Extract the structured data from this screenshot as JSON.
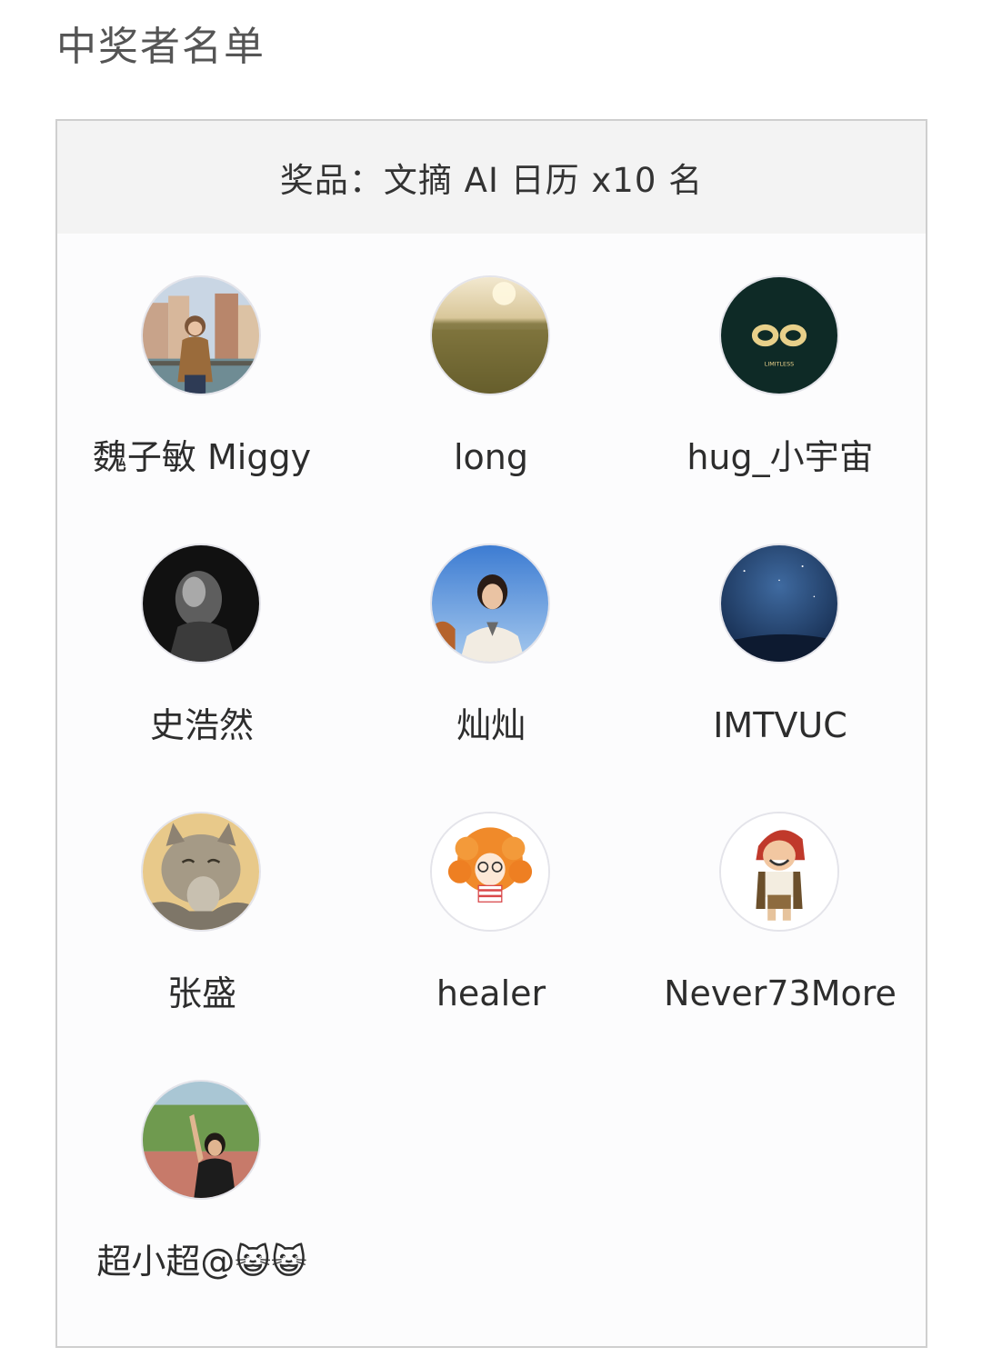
{
  "page": {
    "title": "中奖者名单"
  },
  "prize": {
    "label": "奖品：文摘 AI 日历 x10 名"
  },
  "winners": [
    {
      "name": "魏子敏 Miggy",
      "avatar": "photo-avatar-venice"
    },
    {
      "name": "long",
      "avatar": "photo-avatar-wheat-field"
    },
    {
      "name": "hug_小宇宙",
      "avatar": "logo-avatar-limitless"
    },
    {
      "name": "史浩然",
      "avatar": "photo-avatar-bw-portrait"
    },
    {
      "name": "灿灿",
      "avatar": "photo-avatar-girl-sky"
    },
    {
      "name": "IMTVUC",
      "avatar": "photo-avatar-starry-sky"
    },
    {
      "name": "张盛",
      "avatar": "photo-avatar-cat"
    },
    {
      "name": "healer",
      "avatar": "cartoon-avatar-curly-hair"
    },
    {
      "name": "Never73More",
      "avatar": "cartoon-avatar-pirate"
    },
    {
      "name": "超小超@😺😺",
      "avatar": "photo-avatar-peace-sign"
    }
  ],
  "logo_text": "LIMITLESS",
  "colors": {
    "card_border": "#cfcfcf",
    "prize_bar_bg": "#f3f3f3",
    "title_text": "#555555",
    "name_text": "#2d2d2d"
  }
}
